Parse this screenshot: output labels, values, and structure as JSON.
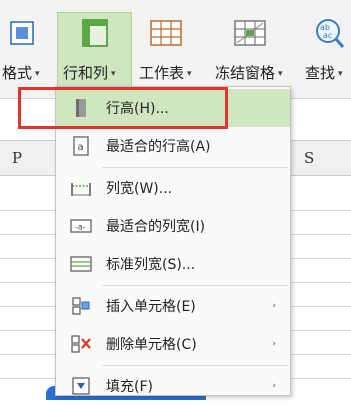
{
  "toolbar": {
    "format_label": "格式",
    "rowcol_label": "行和列",
    "worksheet_label": "工作表",
    "freeze_label": "冻结窗格",
    "find_label": "查找",
    "arrow": "▾"
  },
  "sheet": {
    "col_p": "P",
    "col_s": "S"
  },
  "menu": {
    "items": [
      {
        "label": "行高(H)...",
        "icon": "row-height-icon"
      },
      {
        "label": "最适合的行高(A)",
        "icon": "autofit-row-icon"
      },
      {
        "label": "列宽(W)...",
        "icon": "column-width-icon"
      },
      {
        "label": "最适合的列宽(I)",
        "icon": "autofit-column-icon"
      },
      {
        "label": "标准列宽(S)...",
        "icon": "standard-width-icon"
      },
      {
        "label": "插入单元格(E)",
        "icon": "insert-cells-icon"
      },
      {
        "label": "删除单元格(C)",
        "icon": "delete-cells-icon"
      },
      {
        "label": "填充(F)",
        "icon": "fill-icon"
      }
    ],
    "submenu_arrow": "›"
  },
  "colors": {
    "highlight": "#cfe6c0",
    "annotation_red": "#e0342f",
    "accent_green": "#3d8b2f"
  }
}
